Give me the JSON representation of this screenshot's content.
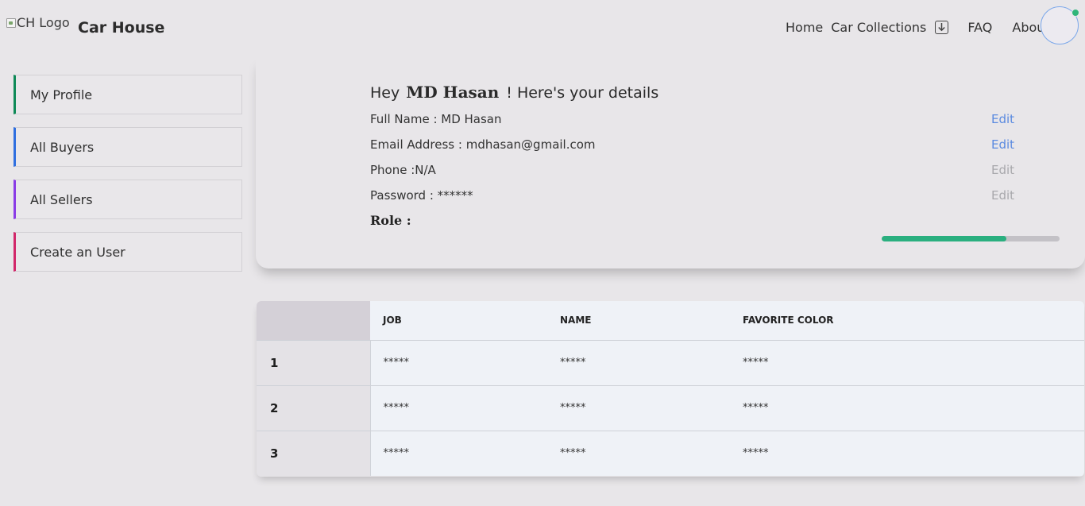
{
  "navbar": {
    "logo_alt": "CH Logo",
    "brand": "Car House",
    "links": {
      "home": "Home",
      "collections": "Car Collections",
      "faq": "FAQ",
      "about": "About"
    },
    "icons": {
      "collections_dropdown": "arrow-down-box-icon",
      "status": "online-dot"
    }
  },
  "sidebar": {
    "items": [
      {
        "label": "My Profile",
        "accent": "#0e8a57"
      },
      {
        "label": "All Buyers",
        "accent": "#2f6fe0"
      },
      {
        "label": "All Sellers",
        "accent": "#8a3ce6"
      },
      {
        "label": "Create an User",
        "accent": "#d2286a"
      }
    ]
  },
  "profile": {
    "greeting_prefix": "Hey",
    "name": "MD Hasan",
    "greeting_suffix": "! Here's your details",
    "full_name": "Full Name : MD Hasan",
    "email": "Email Address : mdhasan@gmail.com",
    "phone": "Phone :N/A",
    "password": "Password : ******",
    "role": "Role :",
    "edit_label": "Edit",
    "completion_percent": 70,
    "colors": {
      "edit_active": "#5a8ae0",
      "edit_disabled": "#a8a8ac",
      "progress": "#2aaf7f"
    }
  },
  "table": {
    "headers": [
      "",
      "JOB",
      "NAME",
      "FAVORITE COLOR"
    ],
    "rows": [
      [
        "1",
        "*****",
        "*****",
        "*****"
      ],
      [
        "2",
        "*****",
        "*****",
        "*****"
      ],
      [
        "3",
        "*****",
        "*****",
        "*****"
      ]
    ]
  }
}
